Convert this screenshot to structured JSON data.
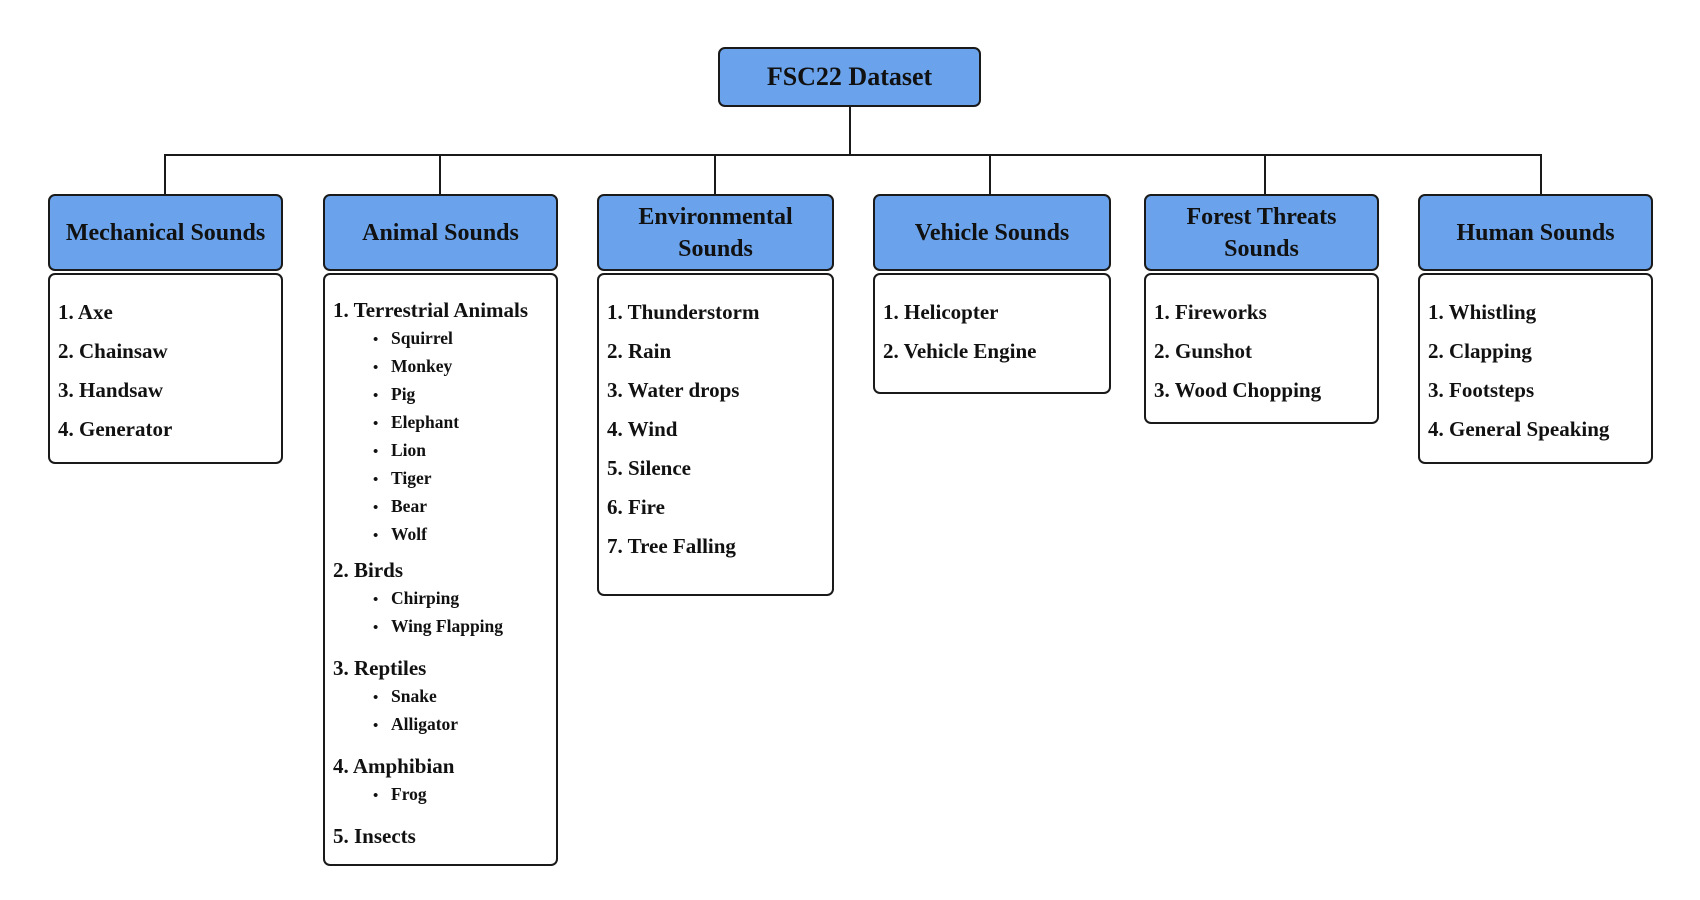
{
  "root": {
    "title": "FSC22 Dataset"
  },
  "categories": [
    {
      "title": "Mechanical Sounds",
      "items": [
        "1. Axe",
        "2. Chainsaw",
        "3. Handsaw",
        "4. Generator"
      ]
    },
    {
      "title": "Animal Sounds",
      "groups": [
        {
          "label": "1. Terrestrial Animals",
          "items": [
            "Squirrel",
            "Monkey",
            "Pig",
            "Elephant",
            "Lion",
            "Tiger",
            "Bear",
            "Wolf"
          ]
        },
        {
          "label": "2. Birds",
          "items": [
            "Chirping",
            "Wing Flapping"
          ]
        },
        {
          "label": "3. Reptiles",
          "items": [
            "Snake",
            "Alligator"
          ]
        },
        {
          "label": "4. Amphibian",
          "items": [
            "Frog"
          ]
        },
        {
          "label": "5. Insects",
          "items": []
        }
      ]
    },
    {
      "title": "Environmental Sounds",
      "items": [
        "1. Thunderstorm",
        "2. Rain",
        "3. Water drops",
        "4. Wind",
        "5. Silence",
        "6. Fire",
        "7. Tree Falling"
      ]
    },
    {
      "title": "Vehicle Sounds",
      "items": [
        "1. Helicopter",
        "2. Vehicle Engine"
      ]
    },
    {
      "title": "Forest Threats Sounds",
      "items": [
        "1. Fireworks",
        "2. Gunshot",
        "3. Wood Chopping"
      ]
    },
    {
      "title": "Human Sounds",
      "items": [
        "1. Whistling",
        "2. Clapping",
        "3. Footsteps",
        "4. General Speaking"
      ]
    }
  ],
  "colors": {
    "header_fill": "#6aa3ec",
    "border": "#1a1a1a"
  }
}
